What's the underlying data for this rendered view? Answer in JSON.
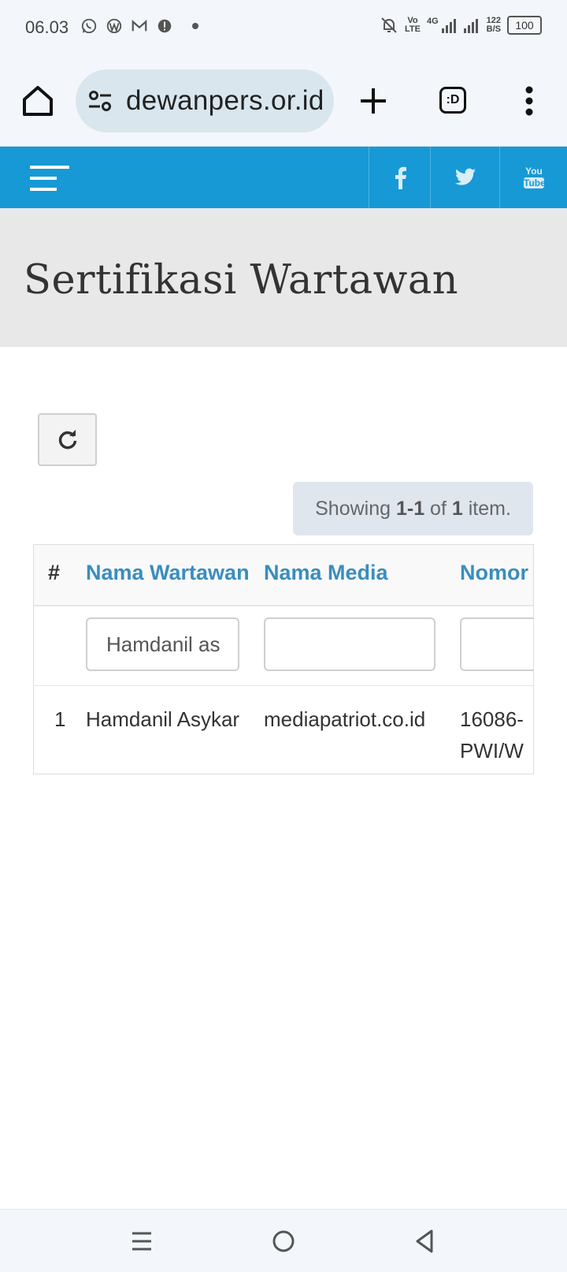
{
  "status_bar": {
    "time": "06.03",
    "volte_top": "Vo",
    "volte_bottom": "LTE",
    "net_type": "4G",
    "speed_top": "122",
    "speed_bottom": "B/S",
    "battery": "100"
  },
  "browser": {
    "url": "dewanpers.or.id",
    "tabs_label": ":D"
  },
  "site": {
    "header_color": "#1799d5",
    "social": [
      "facebook-icon",
      "twitter-icon",
      "youtube-icon"
    ],
    "youtube_top": "You",
    "youtube_bottom": "Tube"
  },
  "page": {
    "title": "Sertifikasi Wartawan"
  },
  "summary": {
    "prefix": "Showing ",
    "range": "1-1",
    "mid": " of ",
    "total": "1",
    "suffix": " item."
  },
  "table": {
    "headers": [
      "#",
      "Nama Wartawan",
      "Nama Media",
      "Nomor"
    ],
    "filters": {
      "nama_wartawan": "Hamdanil as",
      "nama_media": "",
      "nomor": ""
    },
    "rows": [
      {
        "no": "1",
        "nama_wartawan": "Hamdanil Asykar",
        "nama_media": "mediapatriot.co.id",
        "nomor_line1": "16086-",
        "nomor_line2": "PWI/W"
      }
    ]
  }
}
